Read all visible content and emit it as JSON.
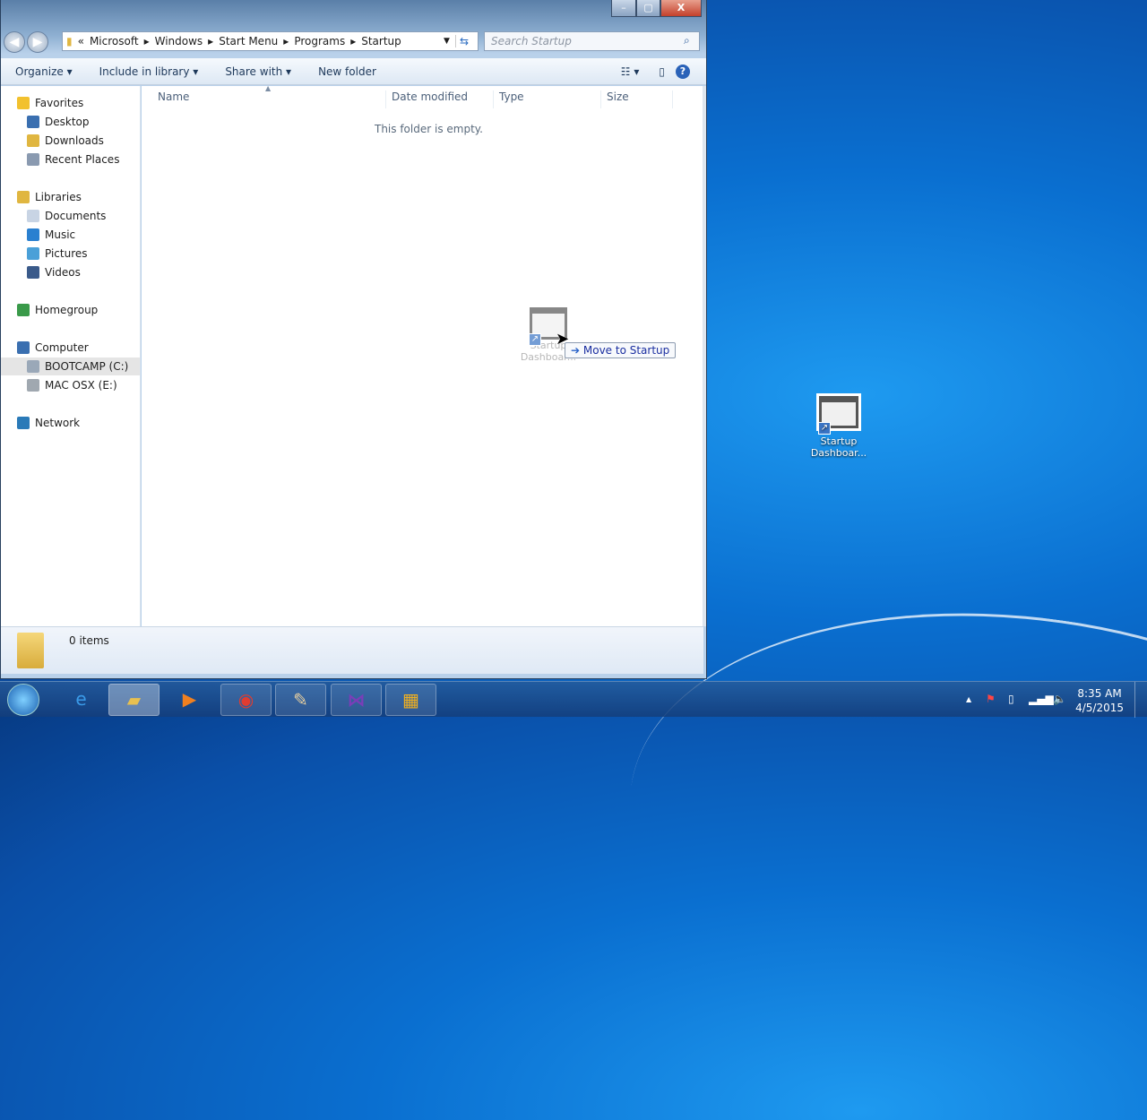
{
  "window": {
    "breadcrumb": [
      "«",
      "Microsoft",
      "Windows",
      "Start Menu",
      "Programs",
      "Startup"
    ],
    "search_placeholder": "Search Startup",
    "minimize": "–",
    "maximize": "▢",
    "close": "X"
  },
  "toolbar": {
    "organize": "Organize ▾",
    "include": "Include in library ▾",
    "share": "Share with ▾",
    "new_folder": "New folder",
    "views": "☷ ▾",
    "preview": "▯",
    "help": "?"
  },
  "sidebar": {
    "items": [
      "Favorites",
      "Desktop",
      "Downloads",
      "Recent Places",
      "Libraries",
      "Documents",
      "Music",
      "Pictures",
      "Videos",
      "Homegroup",
      "Computer",
      "BOOTCAMP (C:)",
      "MAC OSX (E:)",
      "Network"
    ]
  },
  "columns": [
    "Name",
    "Date modified",
    "Type",
    "Size"
  ],
  "empty_message": "This folder is empty.",
  "status": {
    "count": "0 items"
  },
  "drag": {
    "label_line1": "Startup",
    "label_line2": "Dashboar...",
    "tooltip": "Move to Startup"
  },
  "desktop_icon": {
    "label_line1": "Startup",
    "label_line2": "Dashboar..."
  },
  "taskbar": {
    "time": "8:35 AM",
    "date": "4/5/2015"
  }
}
